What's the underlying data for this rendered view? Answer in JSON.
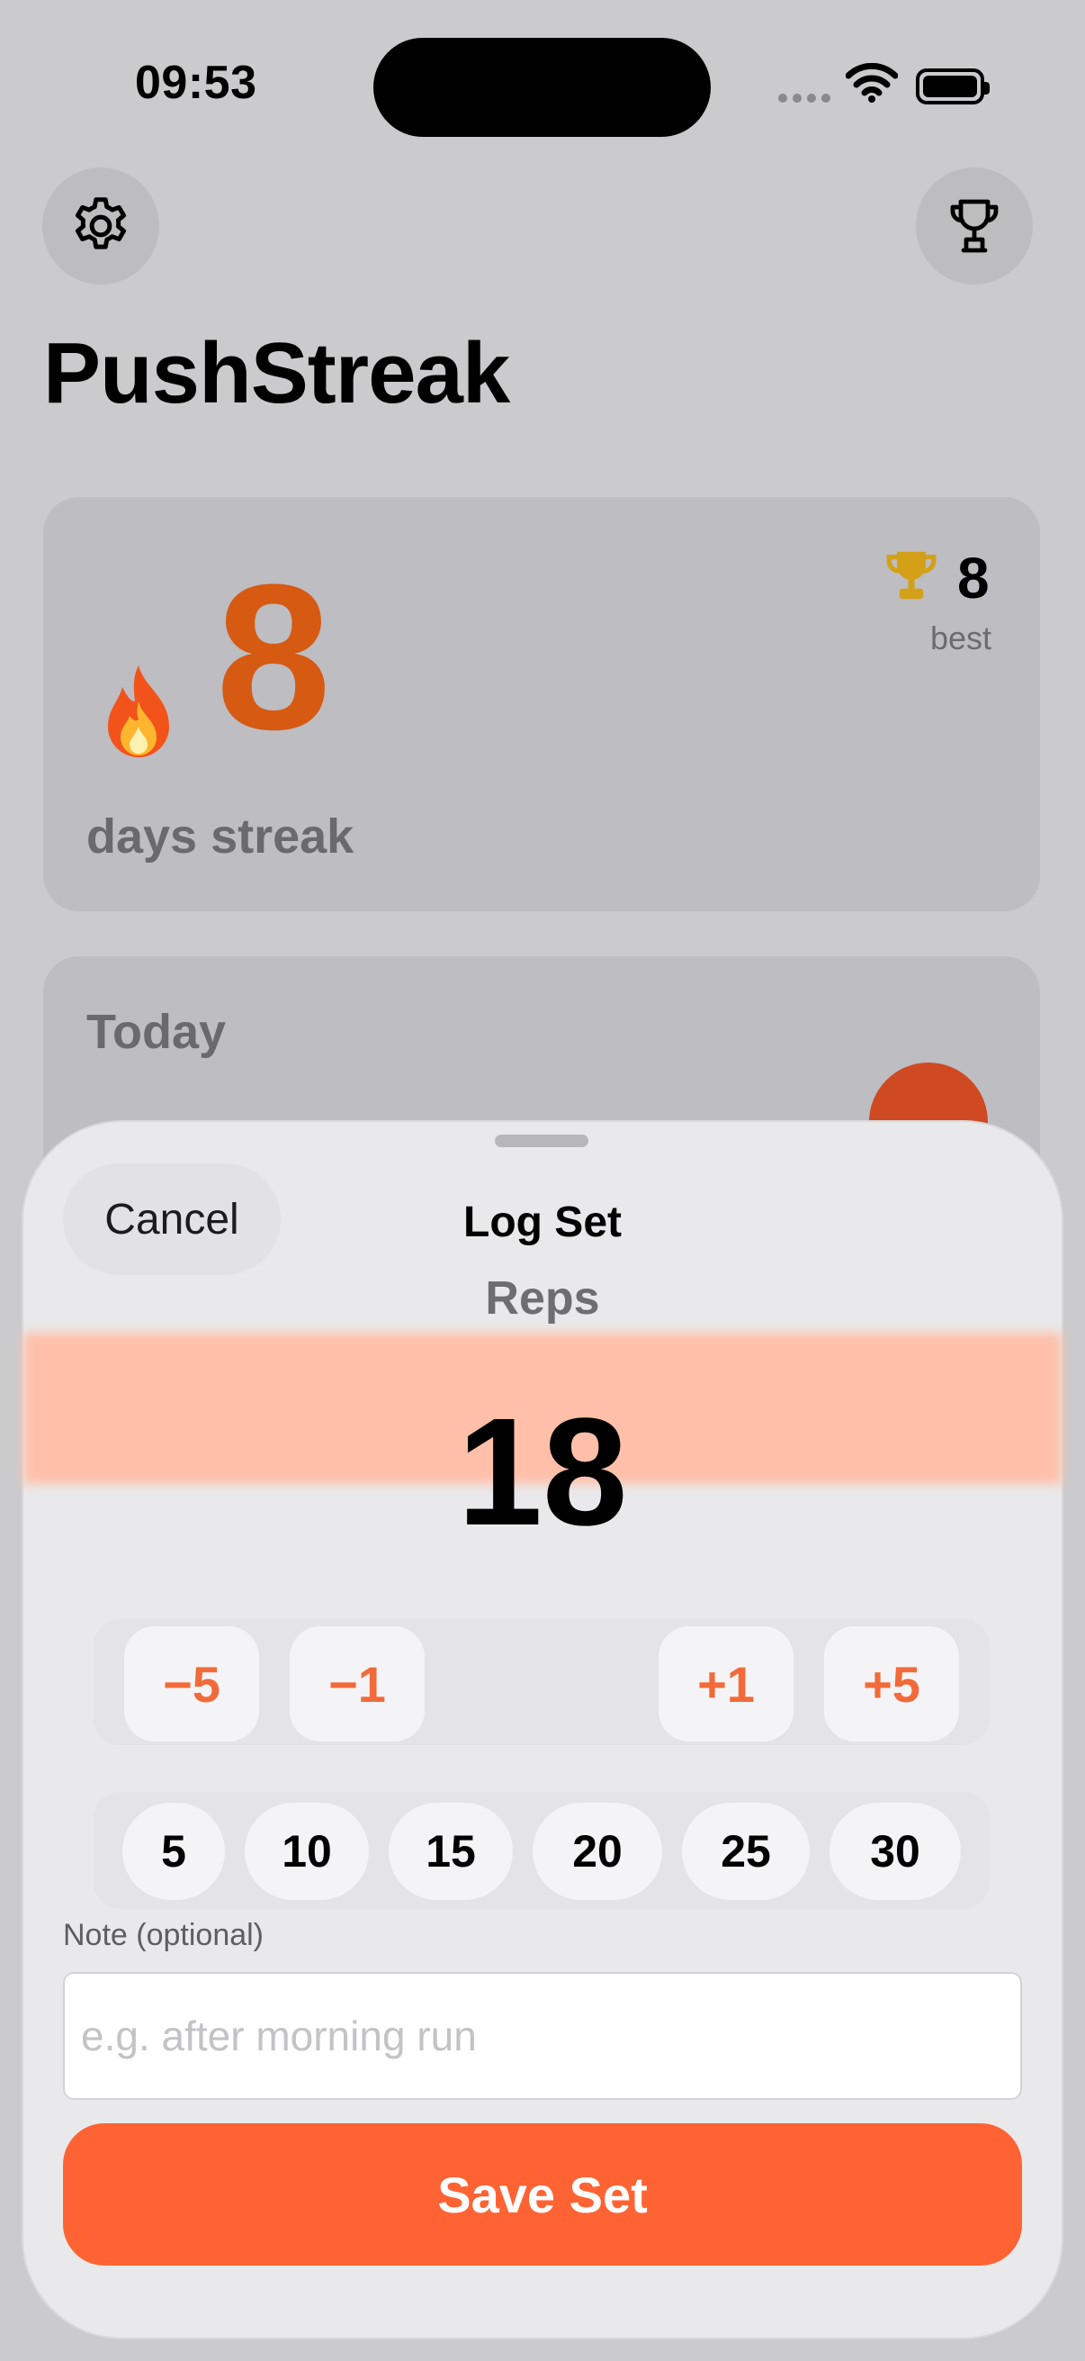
{
  "status_bar": {
    "time": "09:53"
  },
  "header": {
    "settings_icon": "gear-icon",
    "trophy_icon": "trophy-icon"
  },
  "app_title": "PushStreak",
  "streak": {
    "count": "8",
    "label": "days streak",
    "best_value": "8",
    "best_label": "best",
    "flame_icon": "flame-icon"
  },
  "today": {
    "label": "Today",
    "check_icon": "checkmark-icon"
  },
  "sheet": {
    "cancel_label": "Cancel",
    "title": "Log Set",
    "reps_label": "Reps",
    "reps_value": "18",
    "steppers": [
      "−5",
      "−1",
      "+1",
      "+5"
    ],
    "quick_values": [
      "5",
      "10",
      "15",
      "20",
      "25",
      "30"
    ],
    "note_label": "Note (optional)",
    "note_placeholder": "e.g. after morning run",
    "note_value": "",
    "save_label": "Save Set"
  },
  "colors": {
    "accent": "#ff6333",
    "streak_orange": "#d65a12",
    "trophy_gold": "#d4a017"
  }
}
